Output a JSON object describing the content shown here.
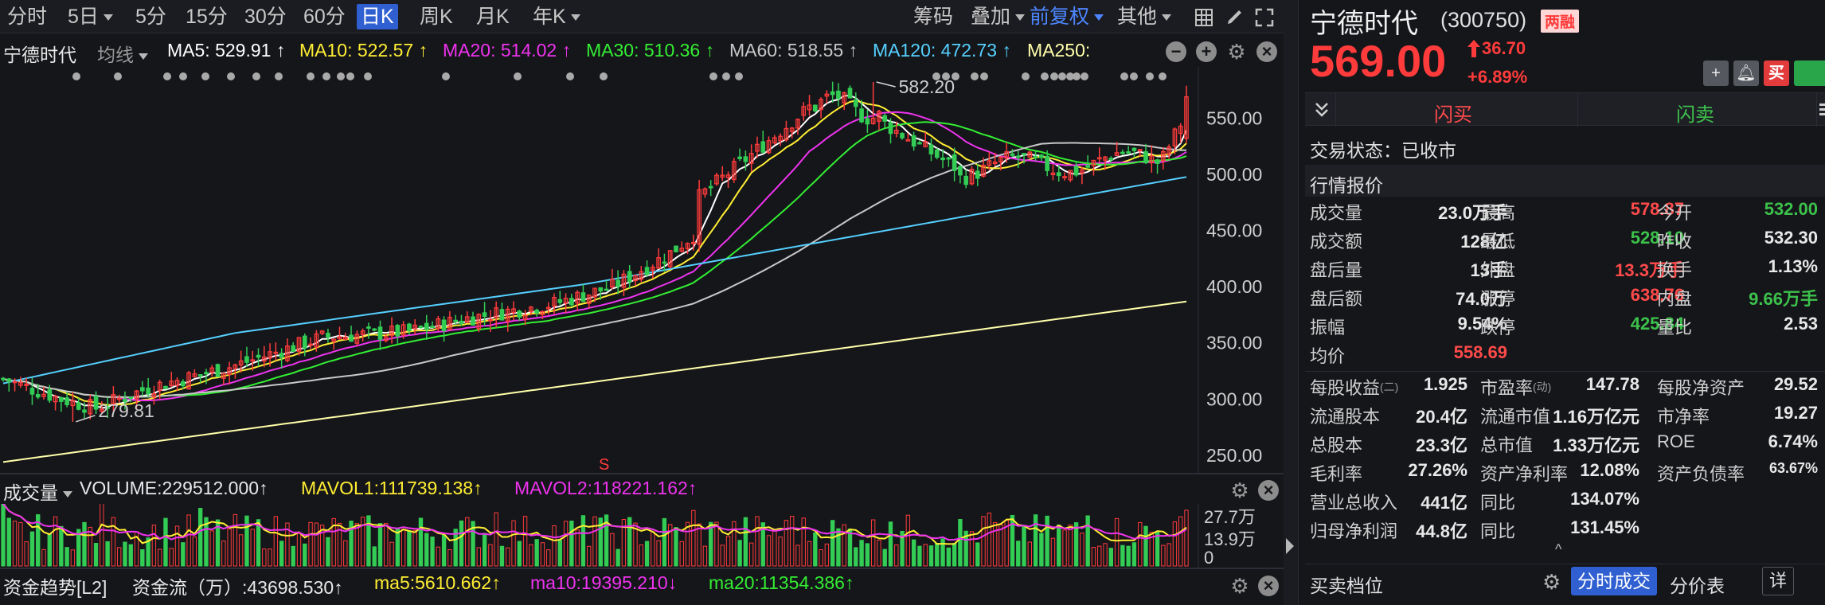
{
  "toolbar": {
    "periods": [
      "分时",
      "5日",
      "5分",
      "15分",
      "30分",
      "60分",
      "日K",
      "周K",
      "月K",
      "年K"
    ],
    "active_period": "日K",
    "tools": [
      "筹码",
      "叠加",
      "前复权",
      "其他"
    ]
  },
  "chart_header": {
    "name": "宁德时代",
    "mode": "均线",
    "ma5": "MA5: 529.91 ↑",
    "ma10": "MA10: 522.57 ↑",
    "ma20": "MA20: 514.02 ↑",
    "ma30": "MA30: 510.36 ↑",
    "ma60": "MA60: 518.55 ↑",
    "ma120": "MA120: 472.73 ↑",
    "ma250": "MA250:"
  },
  "colors": {
    "up": "#ff3b3b",
    "down": "#33cc55",
    "ma5": "#ffffff",
    "ma10": "#ffee33",
    "ma20": "#ee33ee",
    "ma30": "#33ee33",
    "ma60": "#c8c8c8",
    "ma120": "#55d0ff",
    "ma250": "#ffffaa"
  },
  "chart_data": {
    "type": "candlestick",
    "y_ticks": [
      "550.00",
      "500.00",
      "450.00",
      "400.00",
      "350.00",
      "300.00",
      "250.00"
    ],
    "ylim": [
      240,
      590
    ],
    "high_marker": "582.20",
    "low_marker": "279.81",
    "s_marker": "S",
    "high_value": 582.2,
    "low_value": 279.81,
    "volume": {
      "label": "成交量",
      "volume_text": "VOLUME:229512.000↑",
      "mavol1_text": "MAVOL1:111739.138↑",
      "mavol2_text": "MAVOL2:118221.162↑",
      "ticks": [
        "27.7万",
        "13.9万",
        "0"
      ]
    },
    "fund": {
      "label": "资金趋势[L2]",
      "flow_text": "资金流（万）:43698.530↑",
      "ma5_text": "ma5:5610.662↑",
      "ma10_text": "ma10:19395.210↓",
      "ma20_text": "ma20:11354.386↑"
    }
  },
  "stock": {
    "name": "宁德时代",
    "code": "(300750)",
    "badge": "两融",
    "price": "569.00",
    "change": "36.70",
    "change_pct": "+6.89%",
    "buy_btn": "买",
    "flash_buy": "闪买",
    "flash_sell": "闪卖",
    "status": "交易状态：已收市",
    "quote_title": "行情报价"
  },
  "quote": {
    "col1": [
      {
        "label": "成交量",
        "value": "23.0万手",
        "color": "white"
      },
      {
        "label": "成交额",
        "value": "128亿",
        "color": "white"
      },
      {
        "label": "盘后量",
        "value": "13手",
        "color": "white"
      },
      {
        "label": "盘后额",
        "value": "74.0万",
        "color": "white"
      },
      {
        "label": "振幅",
        "value": "9.54%",
        "color": "white"
      },
      {
        "label": "均价",
        "value": "558.69",
        "color": "red"
      }
    ],
    "col2": [
      {
        "label": "最高",
        "value": "578.87",
        "color": "red"
      },
      {
        "label": "最低",
        "value": "528.10",
        "color": "green"
      },
      {
        "label": "外盘",
        "value": "13.3万手",
        "color": "red"
      },
      {
        "label": "涨停",
        "value": "638.76",
        "color": "red"
      },
      {
        "label": "跌停",
        "value": "425.84",
        "color": "green"
      }
    ],
    "col3": [
      {
        "label": "今开",
        "value": "532.00",
        "color": "green"
      },
      {
        "label": "昨收",
        "value": "532.30",
        "color": "white"
      },
      {
        "label": "换手",
        "value": "1.13%",
        "color": "white"
      },
      {
        "label": "内盘",
        "value": "9.66万手",
        "color": "green"
      },
      {
        "label": "量比",
        "value": "2.53",
        "color": "white"
      }
    ]
  },
  "fundamentals": [
    {
      "l1": "每股收益",
      "sub1": "(二)",
      "v1": "1.925",
      "l2": "市盈率",
      "sub2": "(动)",
      "v2": "147.78",
      "l3": "每股净资产",
      "v3": "29.52"
    },
    {
      "l1": "流通股本",
      "sub1": "",
      "v1": "20.4亿",
      "l2": "流通市值",
      "sub2": "",
      "v2": "1.16万亿元",
      "l3": "市净率",
      "v3": "19.27"
    },
    {
      "l1": "总股本",
      "sub1": "",
      "v1": "23.3亿",
      "l2": "总市值",
      "sub2": "",
      "v2": "1.33万亿元",
      "l3": "ROE",
      "v3": "6.74%"
    },
    {
      "l1": "毛利率",
      "sub1": "",
      "v1": "27.26%",
      "l2": "资产净利率",
      "sub2": "",
      "v2": "12.08%",
      "l3": "资产负债率",
      "v3": "63.67%"
    },
    {
      "l1": "营业总收入",
      "sub1": "",
      "v1": "441亿",
      "l2": "同比",
      "sub2": "",
      "v2": "134.07%",
      "l3": "",
      "v3": ""
    },
    {
      "l1": "归母净利润",
      "sub1": "",
      "v1": "44.8亿",
      "l2": "同比",
      "sub2": "",
      "v2": "131.45%",
      "l3": "",
      "v3": ""
    }
  ],
  "bottom_tabs": {
    "orderbook": "买卖档位",
    "tick": "分时成交",
    "price_table": "分价表",
    "detail": "详"
  }
}
